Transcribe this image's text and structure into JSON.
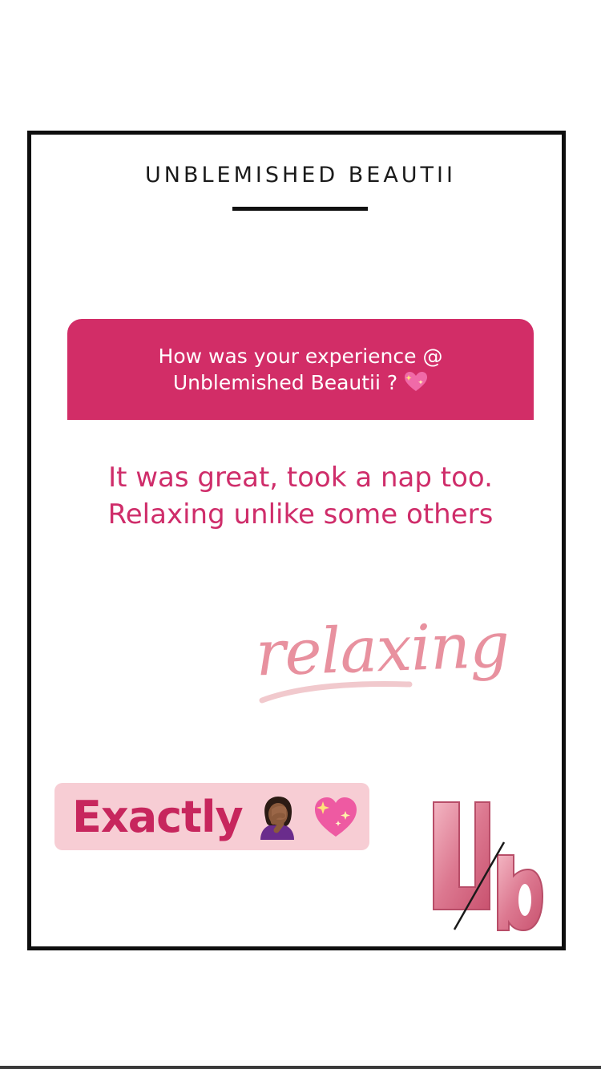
{
  "card": {
    "brand_title": "UNBLEMISHED BEAUTII"
  },
  "question": {
    "line1": "How was your experience @",
    "line2": "Unblemished Beautii ?",
    "emoji": "sparkling-heart"
  },
  "answer": {
    "line1": "It was great, took a nap too.",
    "line2": "Relaxing unlike some others"
  },
  "stickers": {
    "relaxing": "relaxing",
    "exactly": "Exactly",
    "exactly_emojis": [
      "woman-facepalming-icon",
      "sparkling-heart-icon"
    ],
    "logo": "Ub"
  },
  "colors": {
    "question_bg": "#d22d67",
    "answer_text": "#cf2d6a",
    "exactly_pill_bg": "#f7cdd4",
    "exactly_text": "#c7265d",
    "relaxing_text": "#e8919f"
  }
}
